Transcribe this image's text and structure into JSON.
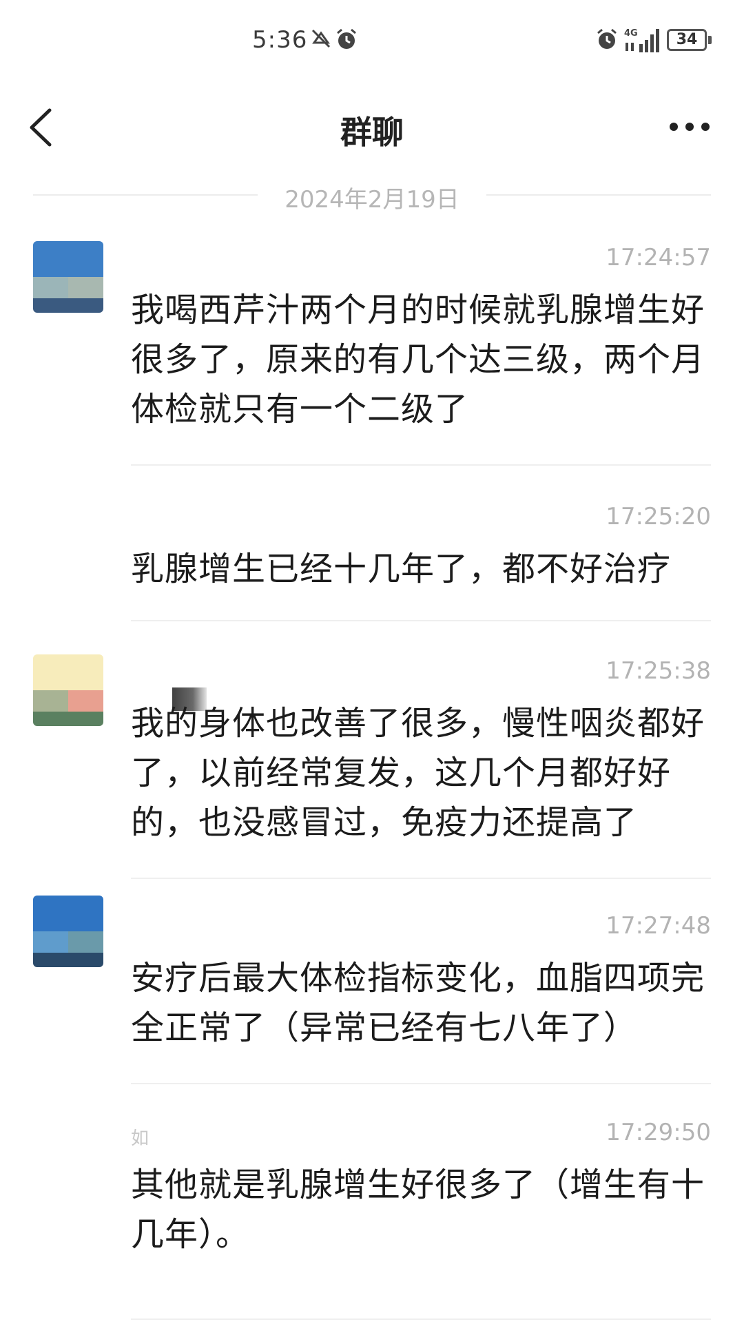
{
  "status_bar": {
    "time": "5:36",
    "network": "4G",
    "battery": "34",
    "icons": [
      "mute-icon",
      "alarm-icon",
      "signal-icon",
      "battery-icon"
    ]
  },
  "header": {
    "title": "群聊",
    "back_icon": "chevron-left-icon",
    "more_icon": "more-dots-icon"
  },
  "date_divider": "2024年2月19日",
  "messages": [
    {
      "time": "17:24:57",
      "text": "我喝西芹汁两个月的时候就乳腺增生好很多了，原来的有几个达三级，两个月体检就只有一个二级了",
      "avatar_colors": [
        "#3d7fc6",
        "#9bb5b8",
        "#a8b8b0",
        "#3a5a80"
      ]
    },
    {
      "time": "17:25:20",
      "text": "乳腺增生已经十几年了，都不好治疗"
    },
    {
      "time": "17:25:38",
      "text": "我的身体也改善了很多，慢性咽炎都好了，以前经常复发，这几个月都好好的，也没感冒过，免疫力还提高了",
      "avatar_colors": [
        "#f7ecbb",
        "#a8b394",
        "#e8a090",
        "#5a8060"
      ]
    },
    {
      "time": "17:27:48",
      "text": "安疗后最大体检指标变化，血脂四项完全正常了（异常已经有七八年了）",
      "avatar_colors": [
        "#2f74c2",
        "#5f9ccc",
        "#6a9aaa",
        "#2a4a6a"
      ]
    },
    {
      "time": "17:29:50",
      "name_fragment": "如",
      "text": "其他就是乳腺增生好很多了（增生有十几年）。"
    }
  ]
}
